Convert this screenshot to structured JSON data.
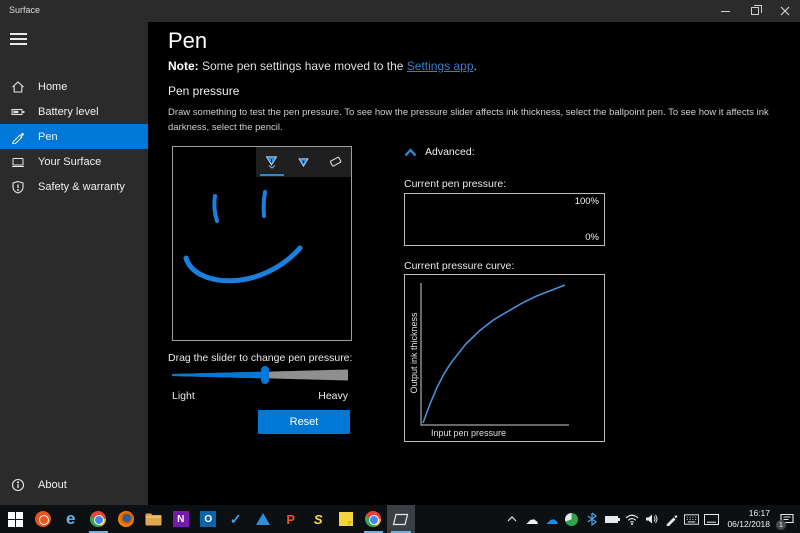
{
  "window": {
    "app_title": "Surface"
  },
  "sidebar": {
    "items": [
      {
        "label": "Home",
        "icon": "home-icon",
        "selected": false
      },
      {
        "label": "Battery level",
        "icon": "battery-icon",
        "selected": false
      },
      {
        "label": "Pen",
        "icon": "pen-icon",
        "selected": true
      },
      {
        "label": "Your Surface",
        "icon": "device-icon",
        "selected": false
      },
      {
        "label": "Safety & warranty",
        "icon": "shield-icon",
        "selected": false
      }
    ],
    "about": {
      "label": "About",
      "icon": "info-icon"
    }
  },
  "main": {
    "title": "Pen",
    "note": {
      "bold": "Note:",
      "text": " Some pen settings have moved to the ",
      "link": "Settings app",
      "suffix": "."
    },
    "section": "Pen pressure",
    "description": "Draw something to test the pen pressure. To see how the pressure slider affects ink thickness, select the ballpoint pen. To see how it affects ink darkness, select the pencil.",
    "tools": {
      "items": [
        "ballpoint-pen",
        "pencil",
        "eraser"
      ],
      "selected": "ballpoint-pen"
    },
    "slider": {
      "label": "Drag the slider to change pen pressure:",
      "min_label": "Light",
      "max_label": "Heavy",
      "value_percent": 53
    },
    "reset_label": "Reset",
    "advanced_label": "Advanced:",
    "meter": {
      "label": "Current pen pressure:",
      "max_label": "100%",
      "min_label": "0%"
    },
    "curve": {
      "label": "Current pressure curve:",
      "ylabel": "Output ink thickness",
      "xlabel": "Input pen pressure"
    }
  },
  "chart_data": {
    "type": "line",
    "title": "Current pressure curve",
    "xlabel": "Input pen pressure",
    "ylabel": "Output ink thickness",
    "x_range": [
      0,
      1
    ],
    "y_range": [
      0,
      1
    ],
    "grid": false,
    "points": [
      [
        0,
        0
      ],
      [
        0.05,
        0.14
      ],
      [
        0.1,
        0.26
      ],
      [
        0.15,
        0.36
      ],
      [
        0.2,
        0.44
      ],
      [
        0.3,
        0.57
      ],
      [
        0.4,
        0.67
      ],
      [
        0.5,
        0.75
      ],
      [
        0.6,
        0.81
      ],
      [
        0.7,
        0.87
      ],
      [
        0.8,
        0.92
      ],
      [
        0.9,
        0.96
      ],
      [
        1,
        1
      ]
    ]
  },
  "taskbar": {
    "apps": [
      {
        "name": "start"
      },
      {
        "name": "ubuntu"
      },
      {
        "name": "edge",
        "glyph": "e"
      },
      {
        "name": "chrome",
        "running": true
      },
      {
        "name": "firefox"
      },
      {
        "name": "file-explorer"
      },
      {
        "name": "onenote",
        "glyph": "N"
      },
      {
        "name": "outlook",
        "glyph": "O"
      },
      {
        "name": "todo",
        "glyph": "✓"
      },
      {
        "name": "blue-triangle-app"
      },
      {
        "name": "p-app",
        "glyph": "P"
      },
      {
        "name": "s-app",
        "glyph": "S"
      },
      {
        "name": "sticky-notes"
      },
      {
        "name": "chrome-2",
        "running": true
      },
      {
        "name": "surface-app",
        "active": true
      }
    ],
    "tray": {
      "icons": [
        "chevron-up",
        "onedrive",
        "onedrive-blue",
        "storage",
        "bluetooth",
        "battery",
        "wifi",
        "volume",
        "pen",
        "touch-keyboard",
        "display"
      ],
      "time": "16:17",
      "date": "06/12/2018",
      "badge": "1"
    }
  },
  "colors": {
    "accent": "#0078d7",
    "link": "#3d7dc4",
    "ink": "#1a80e0",
    "sidebar_bg": "#2b2b2b",
    "taskbar_bg": "#0d1013"
  }
}
